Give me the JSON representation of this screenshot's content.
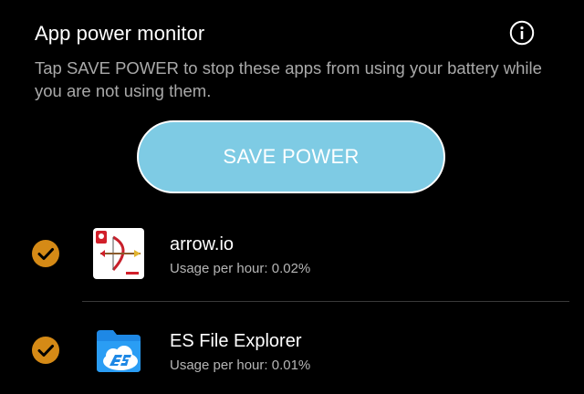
{
  "header": {
    "title": "App power monitor",
    "info_icon": "info-icon",
    "description": "Tap SAVE POWER to stop these apps from using your battery while you are not using them."
  },
  "action": {
    "save_label": "SAVE POWER"
  },
  "apps": [
    {
      "name": "arrow.io",
      "usage_label": "Usage per hour: ",
      "usage_value": "0.02%",
      "checked": true,
      "icon": "arrow-io-app-icon"
    },
    {
      "name": "ES File Explorer",
      "usage_label": "Usage per hour: ",
      "usage_value": "0.01%",
      "checked": true,
      "icon": "es-file-explorer-app-icon"
    }
  ],
  "colors": {
    "background": "#000000",
    "button": "#7ecbe4",
    "check": "#d58a16",
    "primary_text": "#ffffff",
    "secondary_text": "#a9a9a9"
  }
}
